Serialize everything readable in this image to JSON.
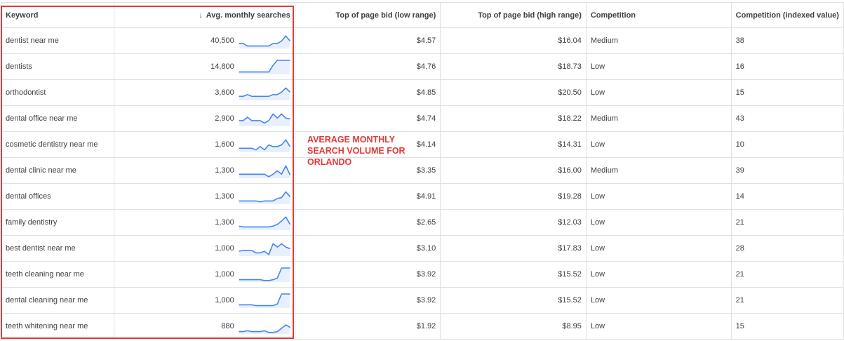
{
  "columns": {
    "keyword": "Keyword",
    "avg": "Avg. monthly searches",
    "low_bid": "Top of page bid (low range)",
    "high_bid": "Top of page bid (high range)",
    "competition": "Competition",
    "competition_idx": "Competition (indexed value)"
  },
  "sort_icon": "arrow-down-icon",
  "annotation": "AVERAGE MONTHLY SEARCH VOLUME FOR ORLANDO",
  "colors": {
    "highlight": "#e53935",
    "sparkline": "#4285f4",
    "sparkline_fill": "#e8f0fe"
  },
  "rows": [
    {
      "keyword": "dentist near me",
      "avg": "40,500",
      "low": "$4.57",
      "high": "$16.04",
      "competition": "Medium",
      "idx": "38",
      "trend": [
        5,
        5,
        2,
        2,
        2,
        2,
        2,
        2,
        5,
        5,
        8,
        14,
        8
      ]
    },
    {
      "keyword": "dentists",
      "avg": "14,800",
      "low": "$4.76",
      "high": "$18.73",
      "competition": "Low",
      "idx": "16",
      "trend": [
        2,
        2,
        2,
        2,
        2,
        2,
        2,
        2,
        10,
        16,
        16,
        16,
        16
      ]
    },
    {
      "keyword": "orthodontist",
      "avg": "3,600",
      "low": "$4.85",
      "high": "$20.50",
      "competition": "Low",
      "idx": "15",
      "trend": [
        4,
        4,
        6,
        4,
        4,
        4,
        4,
        4,
        6,
        6,
        9,
        14,
        9
      ]
    },
    {
      "keyword": "dental office near me",
      "avg": "2,900",
      "low": "$4.74",
      "high": "$18.22",
      "competition": "Medium",
      "idx": "43",
      "trend": [
        6,
        6,
        10,
        6,
        6,
        6,
        3,
        6,
        14,
        9,
        14,
        9,
        8
      ]
    },
    {
      "keyword": "cosmetic dentistry near me",
      "avg": "1,600",
      "low": "$4.14",
      "high": "$14.31",
      "competition": "Low",
      "idx": "10",
      "trend": [
        4,
        4,
        4,
        4,
        2,
        6,
        2,
        8,
        6,
        6,
        8,
        14,
        6
      ]
    },
    {
      "keyword": "dental clinic near me",
      "avg": "1,300",
      "low": "$3.35",
      "high": "$16.00",
      "competition": "Medium",
      "idx": "39",
      "trend": [
        4,
        4,
        4,
        4,
        4,
        4,
        4,
        1,
        4,
        8,
        4,
        14,
        3
      ]
    },
    {
      "keyword": "dental offices",
      "avg": "1,300",
      "low": "$4.91",
      "high": "$19.28",
      "competition": "Low",
      "idx": "14",
      "trend": [
        3,
        3,
        3,
        3,
        3,
        2,
        3,
        3,
        3,
        6,
        7,
        14,
        8
      ]
    },
    {
      "keyword": "family dentistry",
      "avg": "1,300",
      "low": "$2.65",
      "high": "$12.03",
      "competition": "Low",
      "idx": "21",
      "trend": [
        4,
        3,
        3,
        3,
        3,
        3,
        3,
        3,
        4,
        6,
        10,
        15,
        6
      ]
    },
    {
      "keyword": "best dentist near me",
      "avg": "1,000",
      "low": "$3.10",
      "high": "$17.83",
      "competition": "Low",
      "idx": "28",
      "trend": [
        5,
        6,
        6,
        6,
        3,
        3,
        5,
        1,
        14,
        10,
        14,
        10,
        8
      ]
    },
    {
      "keyword": "teeth cleaning near me",
      "avg": "1,000",
      "low": "$3.92",
      "high": "$15.52",
      "competition": "Low",
      "idx": "21",
      "trend": [
        2,
        2,
        2,
        2,
        2,
        2,
        1,
        1,
        2,
        4,
        16,
        16,
        16
      ]
    },
    {
      "keyword": "dental cleaning near me",
      "avg": "1,000",
      "low": "$3.92",
      "high": "$15.52",
      "competition": "Low",
      "idx": "21",
      "trend": [
        3,
        3,
        3,
        3,
        2,
        2,
        2,
        2,
        2,
        4,
        16,
        16,
        16
      ]
    },
    {
      "keyword": "teeth whitening near me",
      "avg": "880",
      "low": "$1.92",
      "high": "$8.95",
      "competition": "Low",
      "idx": "15",
      "trend": [
        2,
        2,
        3,
        2,
        2,
        2,
        3,
        1,
        1,
        2,
        6,
        10,
        7
      ]
    }
  ]
}
